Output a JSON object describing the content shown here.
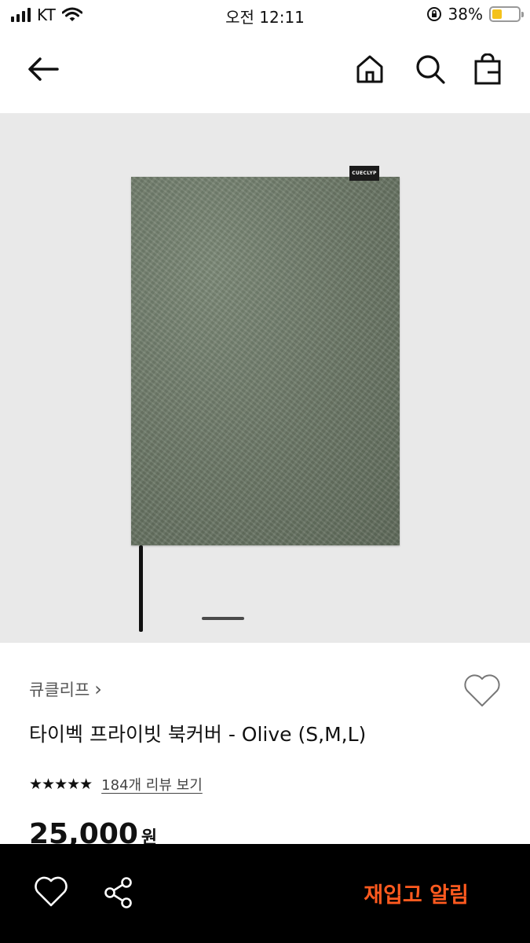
{
  "status_bar": {
    "carrier": "KT",
    "time": "오전 12:11",
    "battery_percent": "38%",
    "battery_level": 0.38,
    "battery_color": "#f4c21b"
  },
  "nav": {
    "back_icon": "arrow-left-icon",
    "home_icon": "home-icon",
    "search_icon": "search-icon",
    "bag_icon": "shopping-bag-icon"
  },
  "product_image": {
    "brand_tag": "CUECLYP",
    "slide_index": 1,
    "background_color": "#e9e9e9",
    "cover_color": "#6b7766"
  },
  "product": {
    "brand": "큐클리프",
    "brand_chevron": "›",
    "title": "타이벡 프라이빗 북커버 - Olive (S,M,L)",
    "rating_stars": "★★★★★",
    "rating": 5,
    "review_link": "184개 리뷰 보기",
    "price": "25,000",
    "price_unit": "원"
  },
  "bottom_bar": {
    "restock_label": "재입고 알림",
    "accent_color": "#ff5a1f",
    "like_icon": "heart-icon",
    "share_icon": "share-icon"
  }
}
